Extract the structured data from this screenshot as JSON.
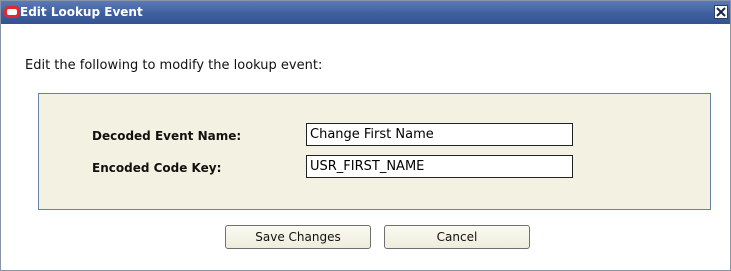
{
  "dialog": {
    "title": "Edit Lookup Event",
    "close_icon": "close-icon",
    "logo_icon": "oracle-logo-icon"
  },
  "instructions": "Edit the following to modify the lookup event:",
  "form": {
    "decoded_event_name": {
      "label": "Decoded Event Name:",
      "value": "Change First Name"
    },
    "encoded_code_key": {
      "label": "Encoded Code Key:",
      "value": "USR_FIRST_NAME"
    }
  },
  "buttons": {
    "save_label": "Save Changes",
    "cancel_label": "Cancel"
  },
  "colors": {
    "titlebar": "#3e5f9f",
    "panel_background": "#f3f1e1",
    "logo_red": "#e8262b"
  }
}
